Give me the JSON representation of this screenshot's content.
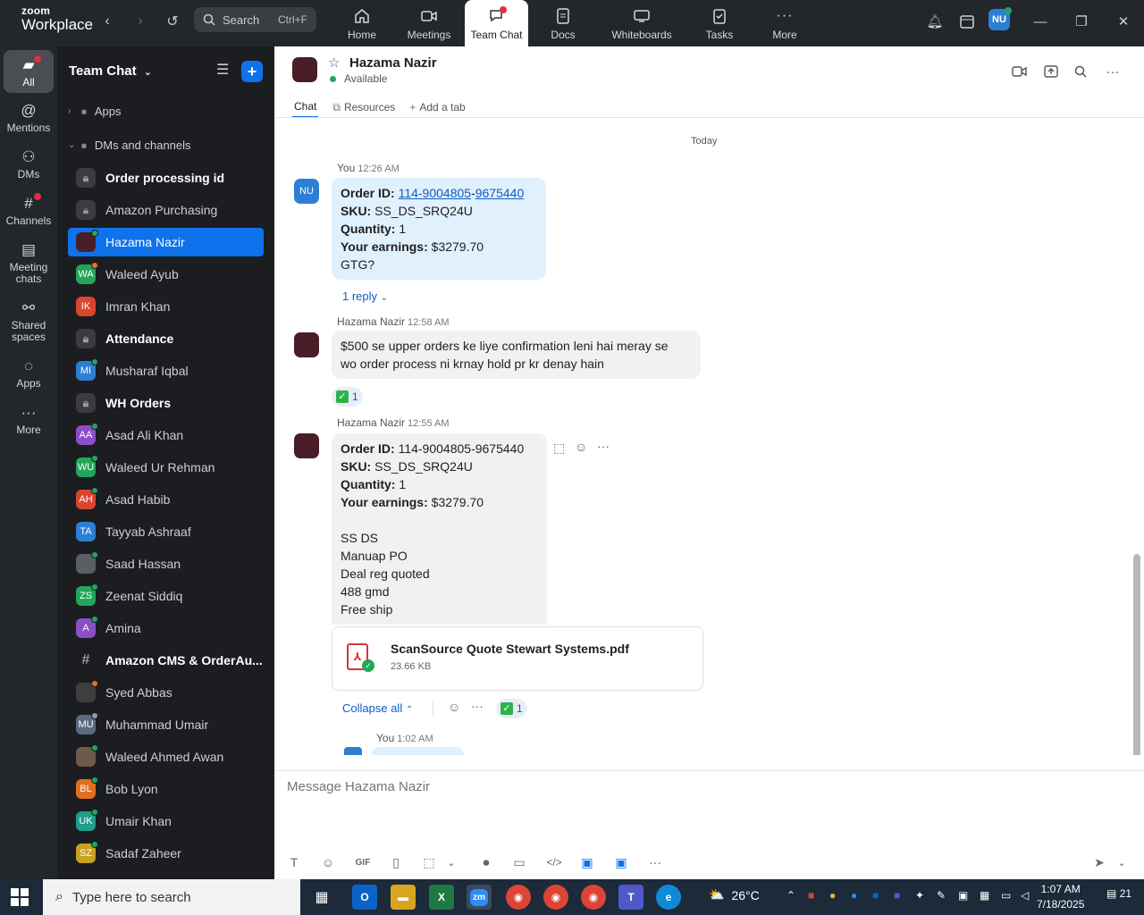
{
  "app": {
    "brand_top": "zoom",
    "brand_bottom": "Workplace"
  },
  "topbar": {
    "search_label": "Search",
    "search_shortcut": "Ctrl+F",
    "nav": [
      {
        "label": "Home",
        "icon": "home-icon"
      },
      {
        "label": "Meetings",
        "icon": "video-icon"
      },
      {
        "label": "Team Chat",
        "icon": "chat-icon"
      },
      {
        "label": "Docs",
        "icon": "docs-icon"
      },
      {
        "label": "Whiteboards",
        "icon": "whiteboard-icon"
      },
      {
        "label": "Tasks",
        "icon": "tasks-icon"
      },
      {
        "label": "More",
        "icon": "more-icon"
      }
    ],
    "active_nav": "Team Chat",
    "user_initials": "NU"
  },
  "rail": [
    {
      "label": "All",
      "icon": "chat-bubble-icon"
    },
    {
      "label": "Mentions",
      "icon": "at-icon"
    },
    {
      "label": "DMs",
      "icon": "people-icon"
    },
    {
      "label": "Channels",
      "icon": "hash-icon"
    },
    {
      "label": "Meeting chats",
      "icon": "calendar-icon"
    },
    {
      "label": "Shared spaces",
      "icon": "share-icon"
    },
    {
      "label": "Apps",
      "icon": "apps-icon"
    },
    {
      "label": "More",
      "icon": "more-icon"
    }
  ],
  "sidebar": {
    "title": "Team Chat",
    "apps_label": "Apps",
    "section_label": "DMs and channels",
    "items": [
      {
        "label": "Order processing id",
        "type": "lock",
        "bold": true
      },
      {
        "label": "Amazon Purchasing",
        "type": "lock",
        "bold": false
      },
      {
        "label": "Hazama Nazir",
        "type": "avatar",
        "initials": "",
        "color": "#4a1e29",
        "status": "#23a55a",
        "active": true
      },
      {
        "label": "Waleed Ayub",
        "type": "avatar",
        "initials": "WA",
        "color": "#23a55a",
        "status": "#e8732a"
      },
      {
        "label": "Imran Khan",
        "type": "avatar",
        "initials": "IK",
        "color": "#d9462e",
        "status": ""
      },
      {
        "label": "Attendance",
        "type": "lock",
        "bold": true
      },
      {
        "label": "Musharaf Iqbal",
        "type": "avatar",
        "initials": "MI",
        "color": "#2d7fd3",
        "status": "#23a55a"
      },
      {
        "label": "WH Orders",
        "type": "lock",
        "bold": true
      },
      {
        "label": "Asad Ali Khan",
        "type": "avatar",
        "initials": "AA",
        "color": "#8a4fc7",
        "status": "#23a55a"
      },
      {
        "label": "Waleed Ur Rehman",
        "type": "avatar",
        "initials": "WU",
        "color": "#23a55a",
        "status": "#23a55a"
      },
      {
        "label": "Asad Habib",
        "type": "avatar",
        "initials": "AH",
        "color": "#d9462e",
        "status": "#23a55a"
      },
      {
        "label": "Tayyab Ashraaf",
        "type": "avatar",
        "initials": "TA",
        "color": "#2d7fd3",
        "status": ""
      },
      {
        "label": "Saad Hassan",
        "type": "avatar",
        "initials": "",
        "color": "#5a5f66",
        "status": "#23a55a"
      },
      {
        "label": "Zeenat Siddiq",
        "type": "avatar",
        "initials": "ZS",
        "color": "#23a55a",
        "status": "#23a55a"
      },
      {
        "label": "Amina",
        "type": "avatar",
        "initials": "A",
        "color": "#8a4fc7",
        "status": "#23a55a"
      },
      {
        "label": "Amazon CMS & OrderAu...",
        "type": "hash",
        "bold": true
      },
      {
        "label": "Syed Abbas",
        "type": "avatar",
        "initials": "",
        "color": "#3e3e3e",
        "status": "#e8732a"
      },
      {
        "label": "Muhammad Umair",
        "type": "avatar",
        "initials": "MU",
        "color": "#5a6a80",
        "status": "#999999"
      },
      {
        "label": "Waleed Ahmed Awan",
        "type": "avatar",
        "initials": "",
        "color": "#6e5a4a",
        "status": "#23a55a"
      },
      {
        "label": "Bob Lyon",
        "type": "avatar",
        "initials": "BL",
        "color": "#e07020",
        "status": "#23a55a"
      },
      {
        "label": "Umair Khan",
        "type": "avatar",
        "initials": "UK",
        "color": "#1f9e8a",
        "status": "#23a55a"
      },
      {
        "label": "Sadaf Zaheer",
        "type": "avatar",
        "initials": "SZ",
        "color": "#c9a020",
        "status": "#23a55a"
      }
    ]
  },
  "chat": {
    "contact_name": "Hazama Nazir",
    "status": "Available",
    "tabs": [
      {
        "label": "Chat",
        "icon": ""
      },
      {
        "label": "Resources",
        "icon": "resources-icon"
      },
      {
        "label": "Add a tab",
        "icon": "plus-icon"
      }
    ],
    "day_label": "Today",
    "messages": {
      "m1": {
        "sender": "You",
        "time": "12:26 AM",
        "initials": "NU",
        "order_label": "Order ID:",
        "order_part1": "114-9004805",
        "order_dash": "-",
        "order_part2": "9675440",
        "sku_label": "SKU:",
        "sku": "SS_DS_SRQ24U",
        "qty_label": "Quantity:",
        "qty": "1",
        "earn_label": "Your earnings:",
        "earn": "$3279.70",
        "extra": "GTG?",
        "replies": "1 reply"
      },
      "m2": {
        "sender": "Hazama Nazir",
        "time": "12:58 AM",
        "line1": "$500 se upper orders ke liye confirmation leni hai meray se",
        "line2": "wo order process ni krnay hold pr kr denay hain",
        "reaction_count": "1"
      },
      "m3": {
        "sender": "Hazama Nazir",
        "time": "12:55 AM",
        "order_label": "Order ID:",
        "order": "114-9004805-9675440",
        "sku_label": "SKU:",
        "sku": "SS_DS_SRQ24U",
        "qty_label": "Quantity:",
        "qty": "1",
        "earn_label": "Your earnings:",
        "earn": "$3279.70",
        "notes": [
          "SS DS",
          "Manuap PO",
          "Deal reg quoted",
          "488 gmd",
          "Free ship"
        ],
        "file_name": "ScanSource Quote Stewart Systems.pdf",
        "file_size": "23.66 KB",
        "collapse_label": "Collapse all",
        "reaction_count": "1"
      },
      "m4": {
        "sender": "You",
        "time": "1:02 AM"
      }
    },
    "composer_placeholder": "Message Hazama Nazir",
    "toolbar": [
      {
        "name": "format-text-icon",
        "glyph": "T"
      },
      {
        "name": "emoji-icon",
        "glyph": "☺"
      },
      {
        "name": "gif-icon",
        "glyph": "GIF"
      },
      {
        "name": "attach-file-icon",
        "glyph": "▯"
      },
      {
        "name": "screenshot-icon",
        "glyph": "⬚"
      },
      {
        "name": "dropdown-icon",
        "glyph": "⌄"
      },
      {
        "name": "microphone-icon",
        "glyph": "🎙"
      },
      {
        "name": "video-message-icon",
        "glyph": "▭"
      },
      {
        "name": "code-snippet-icon",
        "glyph": "</>"
      },
      {
        "name": "app-icon",
        "glyph": "▣"
      },
      {
        "name": "app2-icon",
        "glyph": "▣"
      },
      {
        "name": "more-icon",
        "glyph": "···"
      }
    ]
  },
  "taskbar": {
    "search_placeholder": "Type here to search",
    "temperature": "26°C",
    "time": "1:07 AM",
    "date": "7/18/2025",
    "notifications": "21"
  }
}
